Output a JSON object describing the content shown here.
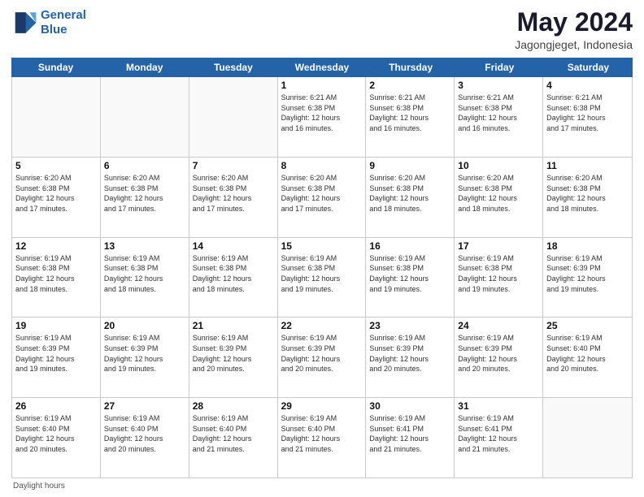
{
  "logo": {
    "line1": "General",
    "line2": "Blue"
  },
  "title": {
    "month": "May 2024",
    "location": "Jagongjeget, Indonesia"
  },
  "header": {
    "days": [
      "Sunday",
      "Monday",
      "Tuesday",
      "Wednesday",
      "Thursday",
      "Friday",
      "Saturday"
    ]
  },
  "footer": {
    "note": "Daylight hours"
  },
  "weeks": [
    [
      {
        "day": "",
        "info": ""
      },
      {
        "day": "",
        "info": ""
      },
      {
        "day": "",
        "info": ""
      },
      {
        "day": "1",
        "info": "Sunrise: 6:21 AM\nSunset: 6:38 PM\nDaylight: 12 hours\nand 16 minutes."
      },
      {
        "day": "2",
        "info": "Sunrise: 6:21 AM\nSunset: 6:38 PM\nDaylight: 12 hours\nand 16 minutes."
      },
      {
        "day": "3",
        "info": "Sunrise: 6:21 AM\nSunset: 6:38 PM\nDaylight: 12 hours\nand 16 minutes."
      },
      {
        "day": "4",
        "info": "Sunrise: 6:21 AM\nSunset: 6:38 PM\nDaylight: 12 hours\nand 17 minutes."
      }
    ],
    [
      {
        "day": "5",
        "info": "Sunrise: 6:20 AM\nSunset: 6:38 PM\nDaylight: 12 hours\nand 17 minutes."
      },
      {
        "day": "6",
        "info": "Sunrise: 6:20 AM\nSunset: 6:38 PM\nDaylight: 12 hours\nand 17 minutes."
      },
      {
        "day": "7",
        "info": "Sunrise: 6:20 AM\nSunset: 6:38 PM\nDaylight: 12 hours\nand 17 minutes."
      },
      {
        "day": "8",
        "info": "Sunrise: 6:20 AM\nSunset: 6:38 PM\nDaylight: 12 hours\nand 17 minutes."
      },
      {
        "day": "9",
        "info": "Sunrise: 6:20 AM\nSunset: 6:38 PM\nDaylight: 12 hours\nand 18 minutes."
      },
      {
        "day": "10",
        "info": "Sunrise: 6:20 AM\nSunset: 6:38 PM\nDaylight: 12 hours\nand 18 minutes."
      },
      {
        "day": "11",
        "info": "Sunrise: 6:20 AM\nSunset: 6:38 PM\nDaylight: 12 hours\nand 18 minutes."
      }
    ],
    [
      {
        "day": "12",
        "info": "Sunrise: 6:19 AM\nSunset: 6:38 PM\nDaylight: 12 hours\nand 18 minutes."
      },
      {
        "day": "13",
        "info": "Sunrise: 6:19 AM\nSunset: 6:38 PM\nDaylight: 12 hours\nand 18 minutes."
      },
      {
        "day": "14",
        "info": "Sunrise: 6:19 AM\nSunset: 6:38 PM\nDaylight: 12 hours\nand 18 minutes."
      },
      {
        "day": "15",
        "info": "Sunrise: 6:19 AM\nSunset: 6:38 PM\nDaylight: 12 hours\nand 19 minutes."
      },
      {
        "day": "16",
        "info": "Sunrise: 6:19 AM\nSunset: 6:38 PM\nDaylight: 12 hours\nand 19 minutes."
      },
      {
        "day": "17",
        "info": "Sunrise: 6:19 AM\nSunset: 6:38 PM\nDaylight: 12 hours\nand 19 minutes."
      },
      {
        "day": "18",
        "info": "Sunrise: 6:19 AM\nSunset: 6:39 PM\nDaylight: 12 hours\nand 19 minutes."
      }
    ],
    [
      {
        "day": "19",
        "info": "Sunrise: 6:19 AM\nSunset: 6:39 PM\nDaylight: 12 hours\nand 19 minutes."
      },
      {
        "day": "20",
        "info": "Sunrise: 6:19 AM\nSunset: 6:39 PM\nDaylight: 12 hours\nand 19 minutes."
      },
      {
        "day": "21",
        "info": "Sunrise: 6:19 AM\nSunset: 6:39 PM\nDaylight: 12 hours\nand 20 minutes."
      },
      {
        "day": "22",
        "info": "Sunrise: 6:19 AM\nSunset: 6:39 PM\nDaylight: 12 hours\nand 20 minutes."
      },
      {
        "day": "23",
        "info": "Sunrise: 6:19 AM\nSunset: 6:39 PM\nDaylight: 12 hours\nand 20 minutes."
      },
      {
        "day": "24",
        "info": "Sunrise: 6:19 AM\nSunset: 6:39 PM\nDaylight: 12 hours\nand 20 minutes."
      },
      {
        "day": "25",
        "info": "Sunrise: 6:19 AM\nSunset: 6:40 PM\nDaylight: 12 hours\nand 20 minutes."
      }
    ],
    [
      {
        "day": "26",
        "info": "Sunrise: 6:19 AM\nSunset: 6:40 PM\nDaylight: 12 hours\nand 20 minutes."
      },
      {
        "day": "27",
        "info": "Sunrise: 6:19 AM\nSunset: 6:40 PM\nDaylight: 12 hours\nand 20 minutes."
      },
      {
        "day": "28",
        "info": "Sunrise: 6:19 AM\nSunset: 6:40 PM\nDaylight: 12 hours\nand 21 minutes."
      },
      {
        "day": "29",
        "info": "Sunrise: 6:19 AM\nSunset: 6:40 PM\nDaylight: 12 hours\nand 21 minutes."
      },
      {
        "day": "30",
        "info": "Sunrise: 6:19 AM\nSunset: 6:41 PM\nDaylight: 12 hours\nand 21 minutes."
      },
      {
        "day": "31",
        "info": "Sunrise: 6:19 AM\nSunset: 6:41 PM\nDaylight: 12 hours\nand 21 minutes."
      },
      {
        "day": "",
        "info": ""
      }
    ]
  ]
}
